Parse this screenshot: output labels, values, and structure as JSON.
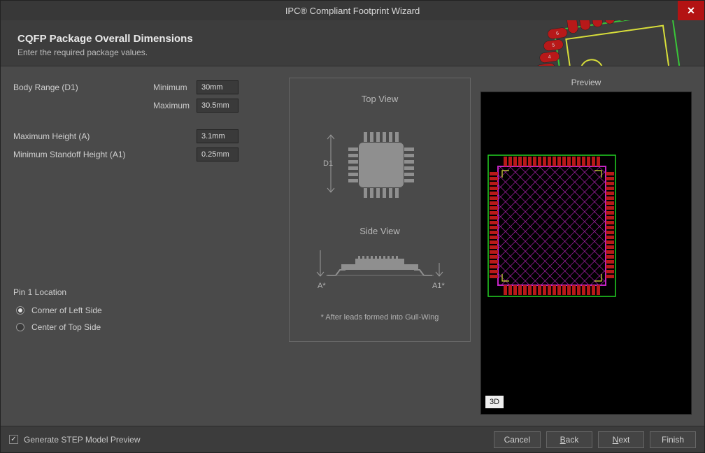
{
  "window": {
    "title": "IPC® Compliant Footprint Wizard"
  },
  "header": {
    "title": "CQFP Package Overall Dimensions",
    "subtitle": "Enter the required package values."
  },
  "fields": {
    "body_range": {
      "label": "Body Range (D1)",
      "min_label": "Minimum",
      "max_label": "Maximum",
      "min": "30mm",
      "max": "30.5mm"
    },
    "max_height": {
      "label": "Maximum Height (A)",
      "value": "3.1mm"
    },
    "min_standoff": {
      "label": "Minimum Standoff Height (A1)",
      "value": "0.25mm"
    }
  },
  "pin1": {
    "section": "Pin 1 Location",
    "opt1": "Corner of Left Side",
    "opt2": "Center of Top Side",
    "selected": 0
  },
  "diagram": {
    "top_view": "Top View",
    "side_view": "Side View",
    "d1": "D1",
    "a": "A*",
    "a1": "A1*",
    "footnote": "* After leads formed into Gull-Wing"
  },
  "preview": {
    "label": "Preview",
    "badge": "3D"
  },
  "footer": {
    "step": "Generate STEP Model Preview",
    "step_checked": true,
    "cancel": "Cancel",
    "back": "Back",
    "next": "Next",
    "finish": "Finish"
  }
}
